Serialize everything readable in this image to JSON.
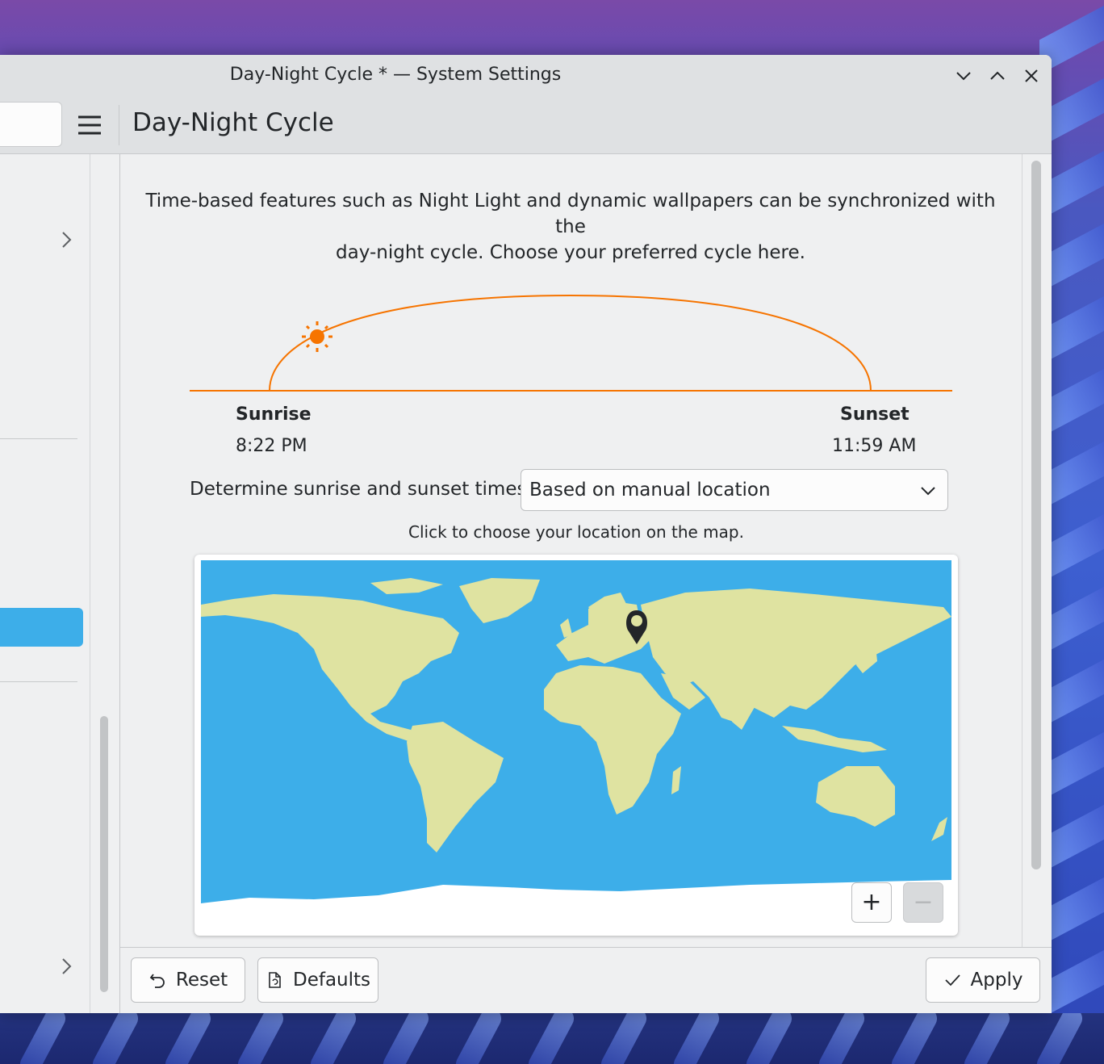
{
  "window": {
    "title": "Day-Night Cycle * — System Settings"
  },
  "titlebar": {
    "minimize_icon": "chevron-down-icon",
    "maximize_icon": "chevron-up-icon",
    "close_icon": "close-icon"
  },
  "header": {
    "menu_icon": "hamburger-menu-icon",
    "page_title": "Day-Night Cycle"
  },
  "main": {
    "intro_line1": "Time-based features such as Night Light and dynamic wallpapers can be synchronized with the",
    "intro_line2": "day-night cycle. Choose your preferred cycle here.",
    "sunrise_label": "Sunrise",
    "sunrise_time": "8:22 PM",
    "sunset_label": "Sunset",
    "sunset_time": "11:59 AM",
    "determine_label": "Determine sunrise and sunset times:",
    "mode_selected": "Based on manual location",
    "map_hint": "Click to choose your location on the map.",
    "zoom_in_label": "+",
    "zoom_out_label": "−"
  },
  "footer": {
    "reset_label": "Reset",
    "defaults_label": "Defaults",
    "apply_label": "Apply"
  },
  "colors": {
    "accent": "#3daee9",
    "sun": "#f67400",
    "ocean": "#3daee9",
    "land": "#dfe3a1"
  }
}
